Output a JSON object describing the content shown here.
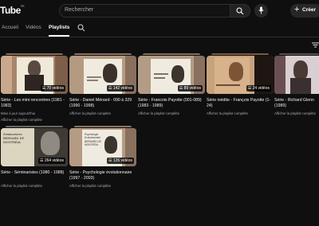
{
  "header": {
    "logo": "Tube",
    "logo_region": "FR",
    "search_placeholder": "Rechercher",
    "create_label": "Créer"
  },
  "tabs": [
    {
      "label": "Accueil"
    },
    {
      "label": "Vidéos"
    },
    {
      "label": "Playlists"
    }
  ],
  "playlists": [
    {
      "title": "Série - Les mini rencontres (1981 - 1983)",
      "count": "70 vidéos",
      "updated": "Mise à jour aujourd'hui",
      "link": "Afficher la playlist complète"
    },
    {
      "title": "Série - Daniel Ménard - 090 à 329 (1990 - 1998)",
      "count": "142 vidéos",
      "link": "Afficher la playlist complète"
    },
    {
      "title": "Série - Francois Payotte (001-089) (1983 - 1989)",
      "count": "89 vidéos",
      "link": "Afficher la playlist complète"
    },
    {
      "title": "Série inédite - François Payotte (1-24)",
      "count": "24 vidéos",
      "link": "Afficher la playlist complète"
    },
    {
      "title": "Série - Richard Glenn (1989)",
      "count": "",
      "link": "Afficher la playlist complète"
    },
    {
      "title": "Série - Séminaristes (1980 - 1988)",
      "count": "264 vidéos",
      "link": "Afficher la playlist complète",
      "thumb_text": "Séminaristes BERNARD DE MONTRÉAL"
    },
    {
      "title": "Série - Psychologie évolutionnaire (1997 - 2003)",
      "count": "126 vidéos",
      "link": "Afficher la playlist complète",
      "thumb_text": "Psychologie Evolutionnaire BERNARD DE MONTRÉAL"
    }
  ],
  "colors": {
    "background": "#0f0f0f",
    "text": "#f1f1f1",
    "secondary_text": "#aaaaaa"
  }
}
